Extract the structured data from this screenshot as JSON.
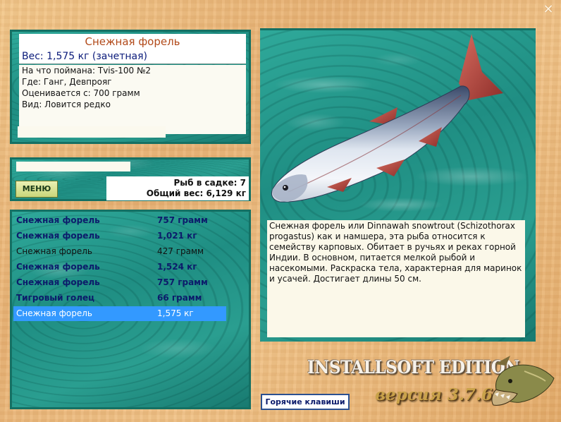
{
  "window": {
    "close_symbol": "✕"
  },
  "info": {
    "fish_name": "Снежная форель",
    "weight_line": "Вес: 1,575 кг (зачетная)",
    "details": [
      "На что поймана: Tvis-100 №2",
      "Где: Ганг, Девпрояг",
      "Оценивается с: 700 грамм",
      "Вид: Ловится редко"
    ]
  },
  "menu": {
    "button_label": "МЕНЮ",
    "fish_in_keepnet": "Рыб в садке: 7",
    "total_weight": "Общий вес: 6,129 кг"
  },
  "catch_list": [
    {
      "name": "Снежная форель",
      "weight": "757 грамм",
      "style": "bold"
    },
    {
      "name": "Снежная форель",
      "weight": "1,021 кг",
      "style": "bold"
    },
    {
      "name": "Снежная форель",
      "weight": "427 грамм",
      "style": "normal"
    },
    {
      "name": "Снежная форель",
      "weight": "1,524 кг",
      "style": "bold"
    },
    {
      "name": "Снежная форель",
      "weight": "757 грамм",
      "style": "bold"
    },
    {
      "name": "Тигровый голец",
      "weight": "66 грамм",
      "style": "bold"
    },
    {
      "name": "Снежная форель",
      "weight": "1,575 кг",
      "style": "selected"
    }
  ],
  "description": "Снежная форель или Dinnawah snowtrout (Schizothorax progastus) как и намшера, эта рыба относится к семейству карповых. Обитает в ручьях и реках горной Индии. В основном, питается мелкой рыбой и насекомыми. Раскраска тела, характерная для маринок и усачей. Достигает длины 50 см.",
  "branding": {
    "edition": "INSTALLSOFT EDITION",
    "version": "версия 3.7.6"
  },
  "hotkeys_label": "Горячие клавиши",
  "icons": {
    "close": "close-icon",
    "fish_picture": "snow-trout-picture",
    "pike_logo": "pike-logo-icon"
  },
  "colors": {
    "frame": "#157063",
    "fish_title": "#b24a1a",
    "list_bold": "#0c1b6b",
    "selection": "#3399ff"
  }
}
